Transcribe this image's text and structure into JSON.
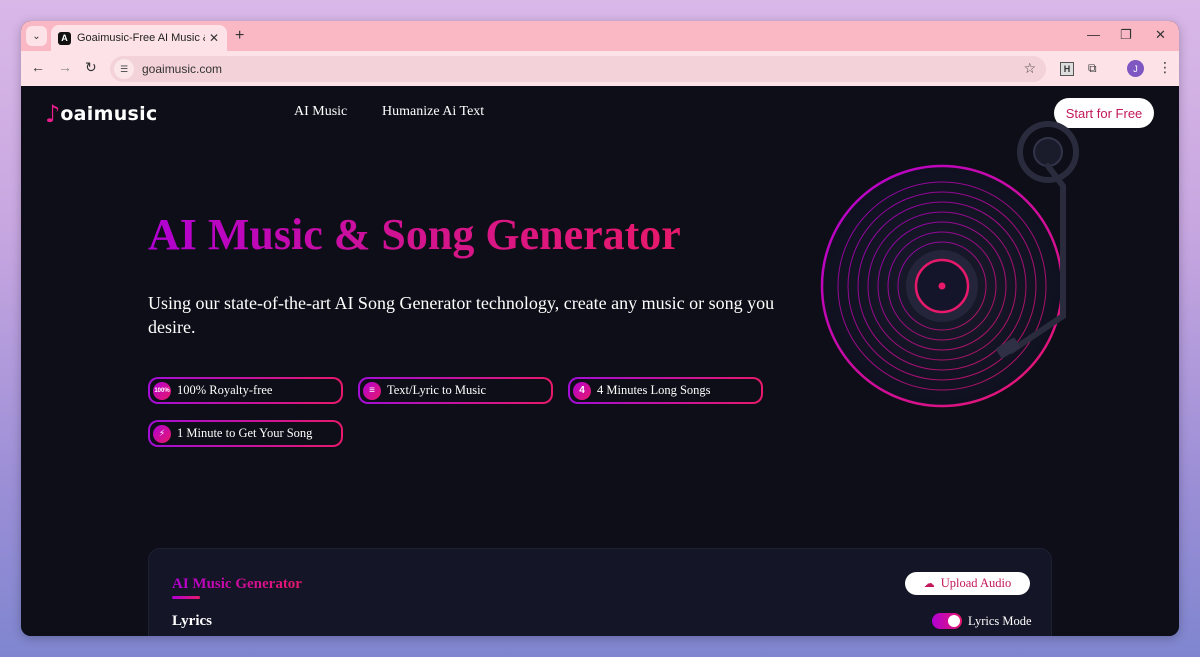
{
  "browser": {
    "tab_title": "Goaimusic-Free AI Music & Son",
    "tab_favicon_letter": "A",
    "tab_close": "✕",
    "new_tab": "+",
    "url": "goaimusic.com",
    "extension_h_label": "H",
    "profile_initial": "J",
    "window_controls": [
      "—",
      "❐",
      "✕"
    ]
  },
  "header": {
    "logo_mark": "♪",
    "logo_text": "oaimusic",
    "nav": [
      "AI Music",
      "Humanize Ai Text"
    ],
    "cta_label": "Start for Free"
  },
  "hero": {
    "title": "AI Music & Song Generator",
    "subtitle": "Using our state-of-the-art AI Song Generator technology, create any music or song you desire.",
    "features": [
      {
        "icon": "100%",
        "label": "100% Royalty-free"
      },
      {
        "icon": "≡",
        "label": "Text/Lyric to Music"
      },
      {
        "icon": "4",
        "label": "4 Minutes Long Songs"
      },
      {
        "icon": "⚡",
        "label": "1 Minute to Get Your Song"
      }
    ]
  },
  "generator": {
    "tab_label": "AI Music Generator",
    "upload_label": "Upload Audio",
    "lyrics_label": "Lyrics",
    "lyrics_mode_label": "Lyrics Mode",
    "lyrics_mode_on": true
  },
  "colors": {
    "accent_start": "#b100d4",
    "accent_end": "#e8196b",
    "page_bg": "#0d0e17",
    "tabstrip_bg": "#f9b8c4"
  }
}
